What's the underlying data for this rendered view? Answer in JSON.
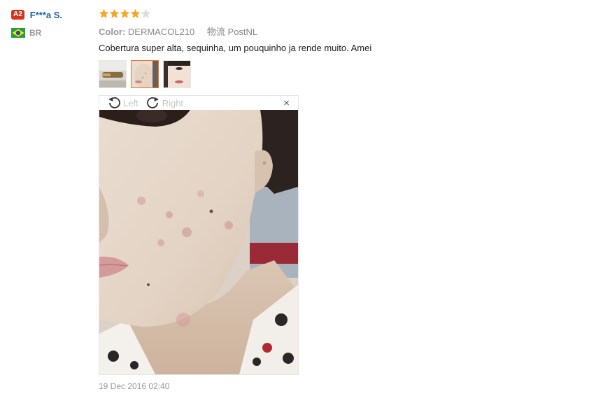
{
  "reviewer": {
    "level": "A2",
    "name": "F***a S.",
    "country_code": "BR"
  },
  "review": {
    "rating": 4,
    "max_rating": 5,
    "color_label": "Color:",
    "color_value": "DERMACOL210",
    "shipping": "物流 PostNL",
    "text": "Cobertura super alta, sequinha, um pouquinho ja rende muito. Amei",
    "date": "19 Dec 2016 02:40"
  },
  "viewer": {
    "rotate_left": "Left",
    "rotate_right": "Right",
    "close": "×"
  },
  "colors": {
    "star_on": "#f5a623",
    "star_off": "#dddddd",
    "accent": "#f57224",
    "user_name": "#1f5fa8"
  }
}
